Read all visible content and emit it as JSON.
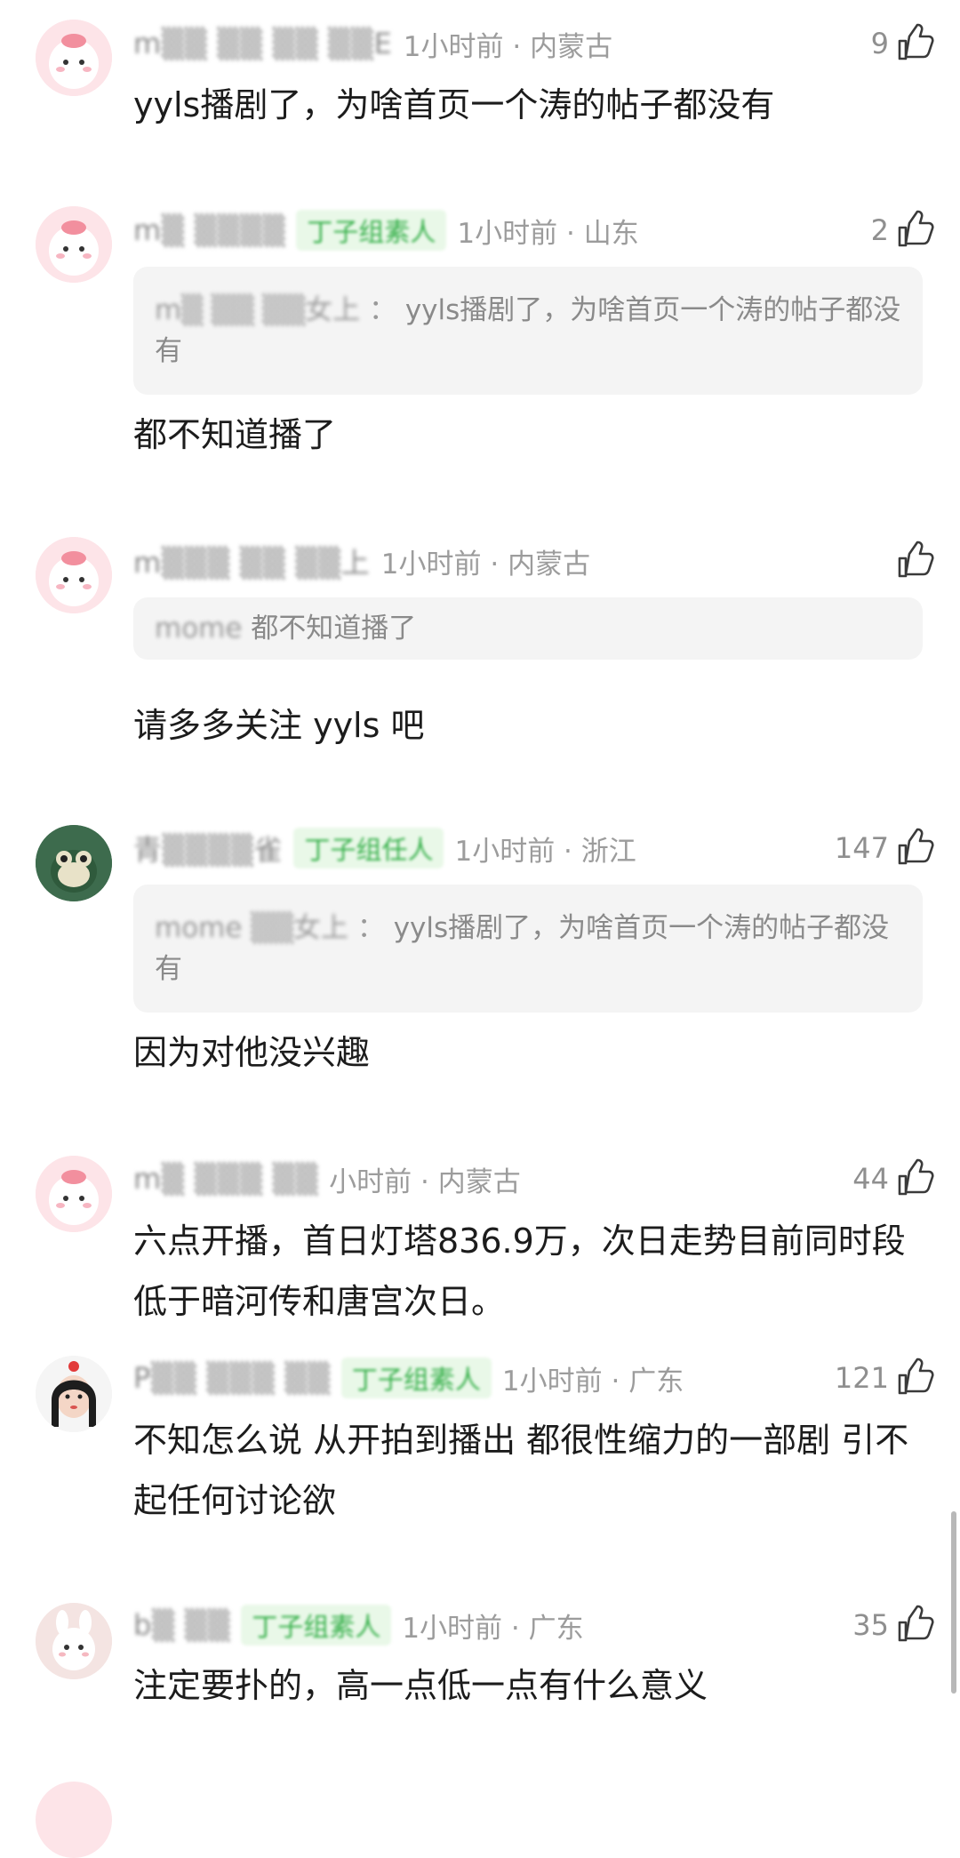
{
  "comments": [
    {
      "username": "m▒▒ ▒▒ ▒▒ ▒▒E",
      "badge": "",
      "meta": "1小时前 · 内蒙古",
      "likes": "9",
      "quote_user": "",
      "quote_text": "",
      "text": "yyls播剧了，为啥首页一个涛的帖子都没有"
    },
    {
      "username": "m▒ ▒▒▒▒",
      "badge": "丁子组素人",
      "meta": "1小时前 · 山东",
      "likes": "2",
      "quote_user": "m▒ ▒▒ ▒▒女上",
      "quote_text": "yyls播剧了，为啥首页一个涛的帖子都没有",
      "text": "都不知道播了"
    },
    {
      "username": "m▒▒▒ ▒▒ ▒▒上",
      "badge": "",
      "meta": "1小时前 · 内蒙古",
      "likes": "",
      "quote_user": "mome",
      "quote_text": "都不知道播了",
      "text": "请多多关注 yyls 吧"
    },
    {
      "username": "青▒▒▒▒雀",
      "badge": "丁子组任人",
      "meta": "1小时前 · 浙江",
      "likes": "147",
      "quote_user": "mome ▒▒女上",
      "quote_text": "yyls播剧了，为啥首页一个涛的帖子都没有",
      "text": "因为对他没兴趣"
    },
    {
      "username": "m▒ ▒▒▒ ▒▒",
      "badge": "",
      "meta": "小时前 · 内蒙古",
      "likes": "44",
      "quote_user": "",
      "quote_text": "",
      "text": "六点开播，首日灯塔836.9万，次日走势目前同时段低于暗河传和唐宫次日。"
    },
    {
      "username": "P▒▒ ▒▒▒ ▒▒",
      "badge": "丁子组素人",
      "meta": "1小时前 · 广东",
      "likes": "121",
      "quote_user": "",
      "quote_text": "",
      "text": "不知怎么说 从开拍到播出 都很性缩力的一部剧 引不起任何讨论欲"
    },
    {
      "username": "b▒ ▒▒",
      "badge": "丁子组素人",
      "meta": "1小时前 · 广东",
      "likes": "35",
      "quote_user": "",
      "quote_text": "",
      "text": "注定要扑的，高一点低一点有什么意义"
    }
  ],
  "colors": {
    "badge_bg": "#e9f8e8",
    "badge_text": "#36b04a",
    "meta": "#9c9c9c",
    "quote_bg": "#f4f4f4"
  },
  "icons": {
    "like": "thumbs-up-icon"
  }
}
